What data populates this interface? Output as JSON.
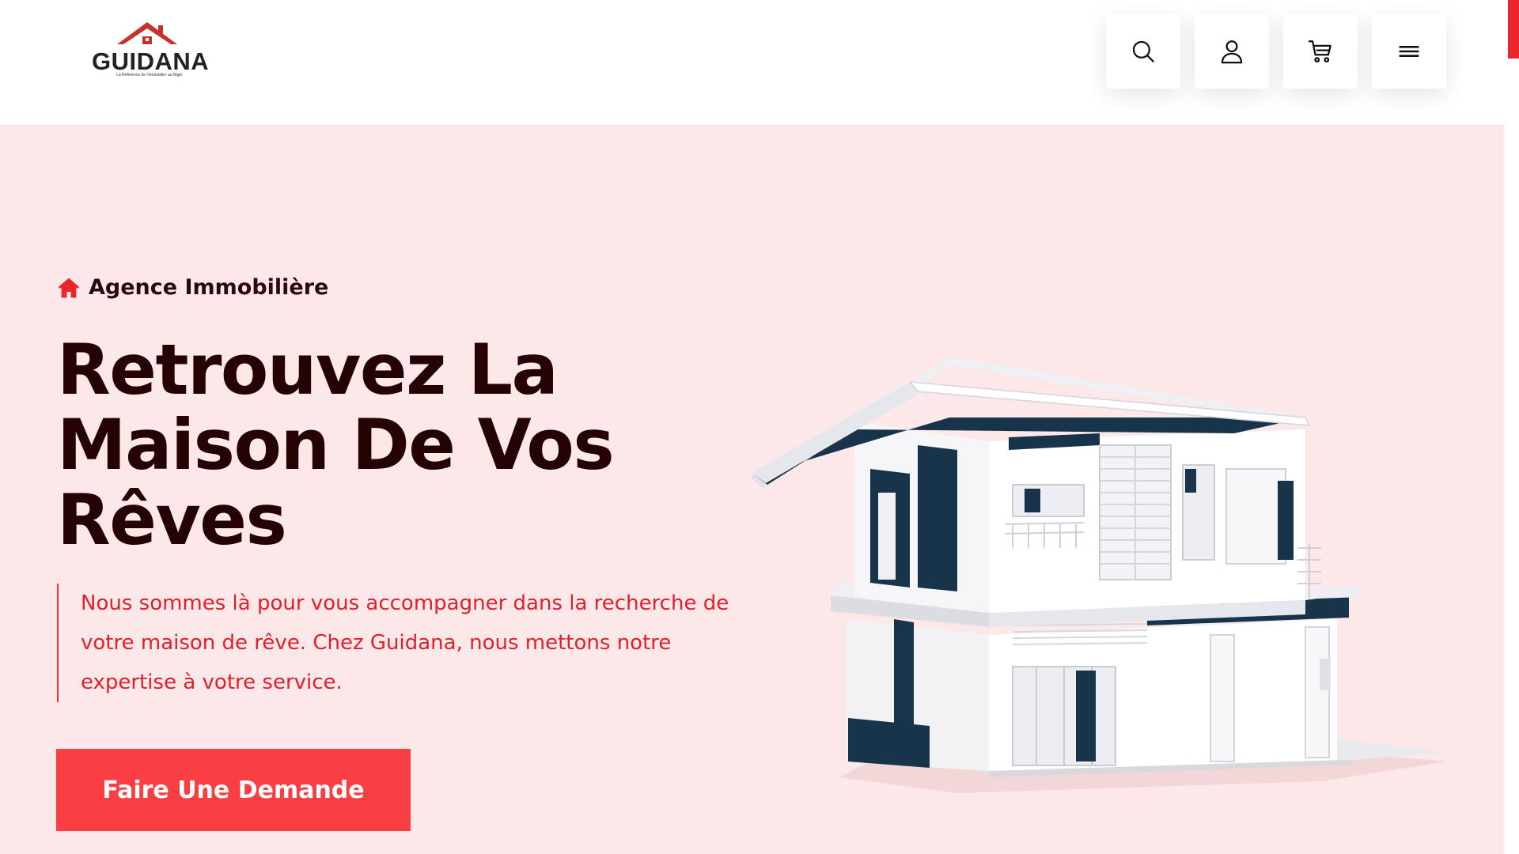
{
  "brand": {
    "name": "GUIDANA",
    "tagline": "La Référence de l'Immobilier au Niger",
    "accent_color": "#e8262c",
    "roof_color": "#c8322e"
  },
  "header": {
    "icons": [
      {
        "name": "search-icon"
      },
      {
        "name": "user-icon"
      },
      {
        "name": "cart-icon"
      },
      {
        "name": "menu-icon"
      }
    ]
  },
  "hero": {
    "eyebrow": "Agence Immobilière",
    "title": "Retrouvez La Maison De Vos Rêves",
    "description": "Nous sommes là pour vous accompagner dans la recherche de votre maison de rêve. Chez Guidana, nous mettons notre expertise à votre service.",
    "cta_label": "Faire Une Demande",
    "background_color": "#fde8e9",
    "title_color": "#250203",
    "desc_color": "#e0202a",
    "cta_color": "#f93e44"
  }
}
